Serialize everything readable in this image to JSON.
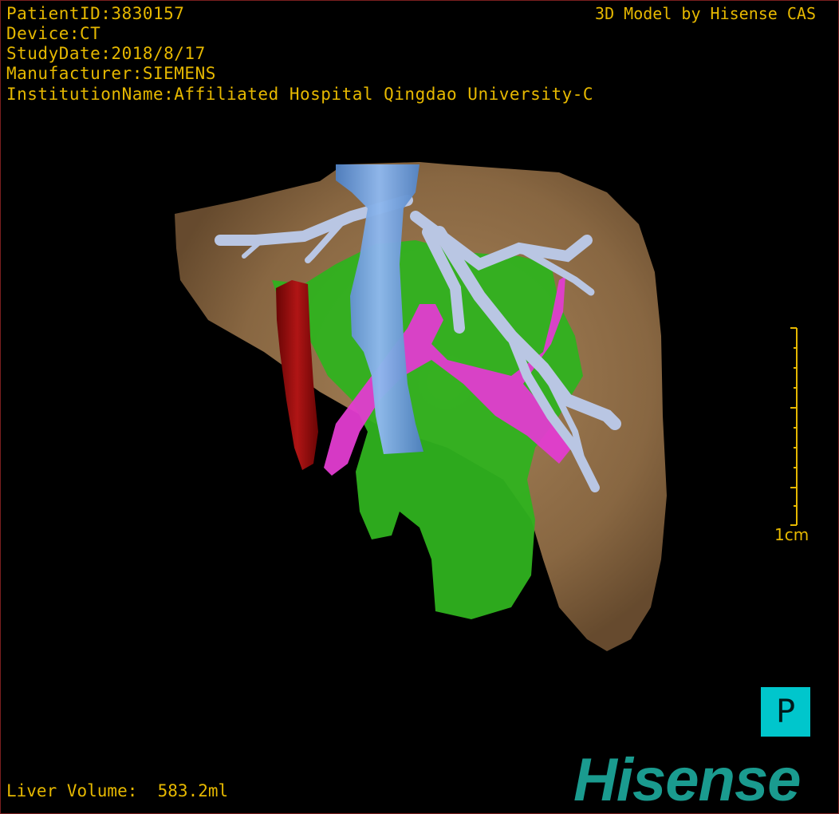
{
  "patient_info": {
    "patient_id": "PatientID:3830157",
    "device": "Device:CT",
    "study_date": "StudyDate:2018/8/17",
    "manufacturer": "Manufacturer:SIEMENS",
    "institution": "InstitutionName:Affiliated Hospital Qingdao University-C"
  },
  "model_credit": "3D Model by Hisense CAS",
  "liver_volume": "Liver Volume:  583.2ml",
  "scale_bar": {
    "label": "1cm"
  },
  "orientation": {
    "label": "P"
  },
  "brand": {
    "logo_text": "Hisense"
  },
  "colors": {
    "text": "#e6b800",
    "liver": "#9c7a52",
    "portal_vein": "#2fb21f",
    "hepatic_vein": "#b9c6e3",
    "ivc": "#6aa0e0",
    "artery": "#9a0c0c",
    "bile_duct": "#e23cd0",
    "orientation_badge": "#00c6cc",
    "brand": "#1a9b8f"
  }
}
